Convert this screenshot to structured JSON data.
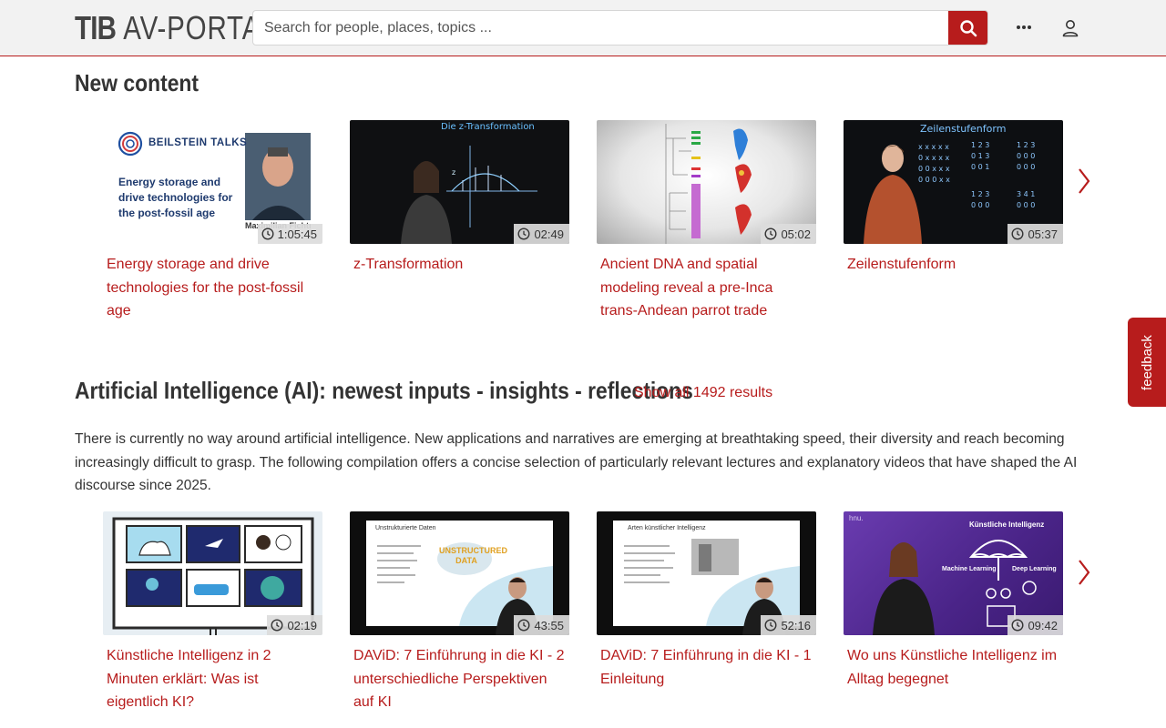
{
  "header": {
    "logo_tib": "TIB",
    "logo_av": "AV-PORTAL",
    "search_placeholder": "Search for people, places, topics ...",
    "search_icon": "search-icon",
    "more_icon": "more-horizontal-icon",
    "user_icon": "user-icon"
  },
  "colors": {
    "accent": "#b71c1c",
    "header_bg": "#f2f2f2"
  },
  "new_content": {
    "title": "New content",
    "cards": [
      {
        "title": "Energy storage and drive technologies for the post-fossil age",
        "duration": "1:05:45",
        "thumb_brand": "BEILSTEIN TALKS",
        "thumb_text": "Energy storage and drive technologies for the post-fossil age",
        "thumb_name": "Maximilian Fichtner"
      },
      {
        "title": "z-Transformation",
        "duration": "02:49",
        "thumb_text": "Die z-Transformation"
      },
      {
        "title": "Ancient DNA and spatial modeling reveal a pre-Inca trans-Andean parrot trade",
        "duration": "05:02"
      },
      {
        "title": "Zeilenstufenform",
        "duration": "05:37",
        "thumb_text": "Zeilenstufenform"
      }
    ]
  },
  "ai_section": {
    "title": "Artificial Intelligence (AI): newest inputs - insights - reflections",
    "show_all": "Show all 1492 results",
    "description": "There is currently no way around artificial intelligence. New applications and narratives are emerging at breathtaking speed, their diversity and reach becoming increasingly difficult to grasp. The following compilation offers a concise selection of particularly relevant lectures and explanatory videos that have shaped the AI discourse since 2025.",
    "cards": [
      {
        "title": "Künstliche Intelligenz in 2 Minuten erklärt: Was ist eigentlich KI?",
        "duration": "02:19"
      },
      {
        "title": "DAViD: 7 Einführung in die KI - 2 unterschiedliche Perspektiven auf KI",
        "duration": "43:55",
        "thumb_text": "Unstrukturierte Daten",
        "thumb_word": "UNSTRUCTURED DATA"
      },
      {
        "title": "DAViD: 7 Einführung in die KI - 1 Einleitung",
        "duration": "52:16",
        "thumb_text": "Arten künstlicher Intelligenz"
      },
      {
        "title": "Wo uns Künstliche Intelligenz im Alltag begegnet",
        "duration": "09:42",
        "thumb_text": "Künstliche Intelligenz",
        "thumb_ml": "Machine Learning",
        "thumb_dl": "Deep Learning",
        "thumb_logo": "hnu."
      }
    ]
  },
  "feedback": {
    "label": "feedback"
  }
}
